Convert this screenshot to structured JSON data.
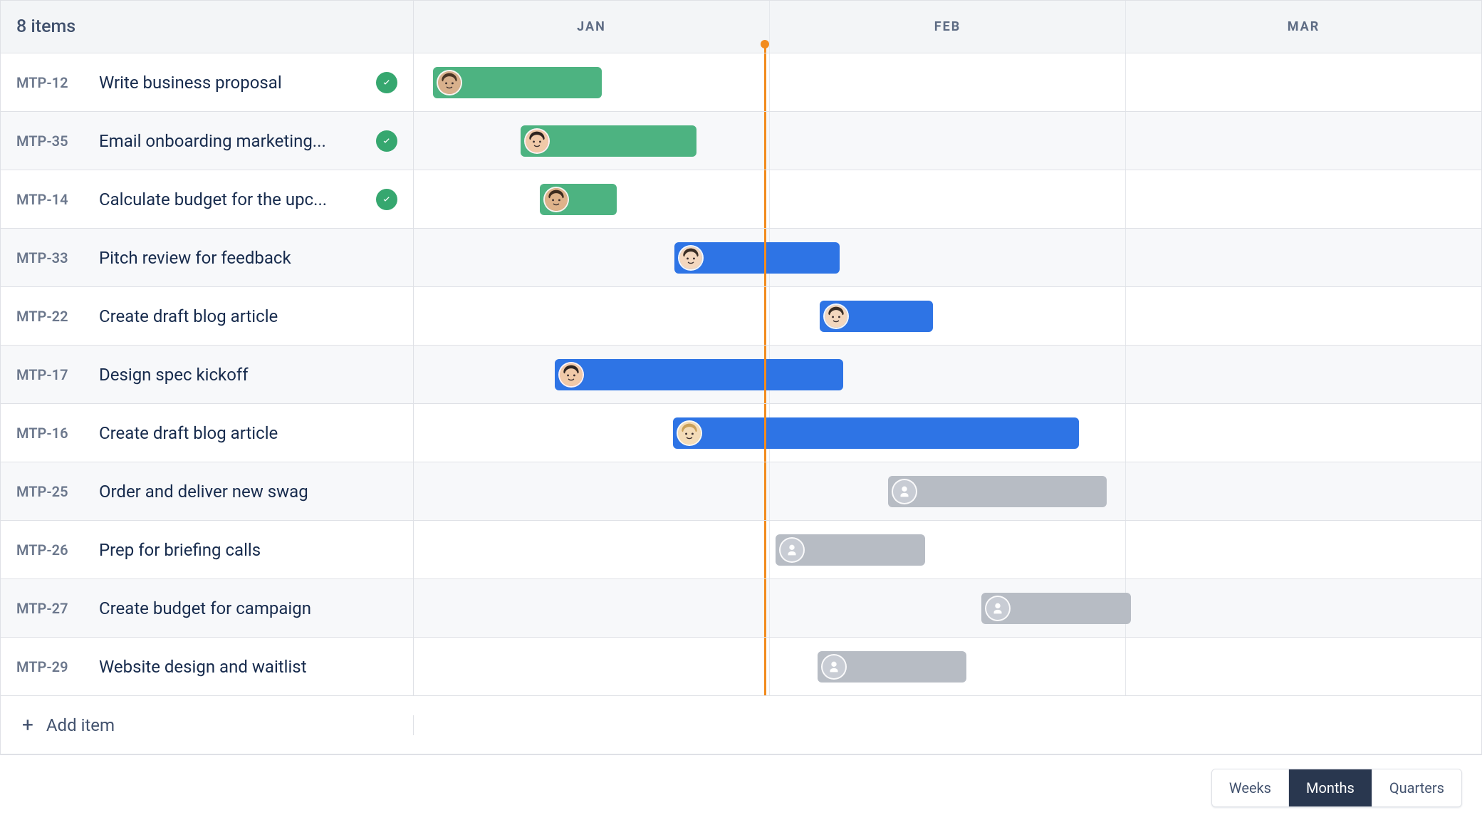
{
  "header": {
    "item_count_label": "8 items",
    "months": [
      "JAN",
      "FEB",
      "MAR"
    ]
  },
  "today_marker_percent": 32.8,
  "rows": [
    {
      "key": "MTP-12",
      "title": "Write business proposal",
      "status": "done",
      "bar": {
        "color": "green",
        "start_pct": 1.8,
        "width_pct": 15.8
      },
      "assignee": "person"
    },
    {
      "key": "MTP-35",
      "title": "Email onboarding marketing...",
      "status": "done",
      "bar": {
        "color": "green",
        "start_pct": 10.0,
        "width_pct": 16.5
      },
      "assignee": "person2"
    },
    {
      "key": "MTP-14",
      "title": "Calculate budget for the upc...",
      "status": "done",
      "bar": {
        "color": "green",
        "start_pct": 11.8,
        "width_pct": 7.2
      },
      "assignee": "person3"
    },
    {
      "key": "MTP-33",
      "title": "Pitch review for feedback",
      "status": "none",
      "bar": {
        "color": "blue",
        "start_pct": 24.4,
        "width_pct": 15.5
      },
      "assignee": "person4"
    },
    {
      "key": "MTP-22",
      "title": "Create draft blog article",
      "status": "none",
      "bar": {
        "color": "blue",
        "start_pct": 38.0,
        "width_pct": 10.6
      },
      "assignee": "person4"
    },
    {
      "key": "MTP-17",
      "title": "Design spec kickoff",
      "status": "none",
      "bar": {
        "color": "blue",
        "start_pct": 13.2,
        "width_pct": 27.0
      },
      "assignee": "person2"
    },
    {
      "key": "MTP-16",
      "title": "Create draft blog article",
      "status": "none",
      "bar": {
        "color": "blue",
        "start_pct": 24.3,
        "width_pct": 38.0
      },
      "assignee": "person5"
    },
    {
      "key": "MTP-25",
      "title": "Order and deliver new swag",
      "status": "none",
      "bar": {
        "color": "grey",
        "start_pct": 44.4,
        "width_pct": 20.5
      },
      "assignee": "none"
    },
    {
      "key": "MTP-26",
      "title": "Prep for briefing calls",
      "status": "none",
      "bar": {
        "color": "grey",
        "start_pct": 33.9,
        "width_pct": 14.0
      },
      "assignee": "none"
    },
    {
      "key": "MTP-27",
      "title": "Create budget for campaign",
      "status": "none",
      "bar": {
        "color": "grey",
        "start_pct": 53.2,
        "width_pct": 14.0
      },
      "assignee": "none"
    },
    {
      "key": "MTP-29",
      "title": "Website design and waitlist",
      "status": "none",
      "bar": {
        "color": "grey",
        "start_pct": 37.8,
        "width_pct": 14.0
      },
      "assignee": "none"
    }
  ],
  "add_item_label": "Add item",
  "zoom": {
    "options": [
      "Weeks",
      "Months",
      "Quarters"
    ],
    "active": "Months"
  }
}
